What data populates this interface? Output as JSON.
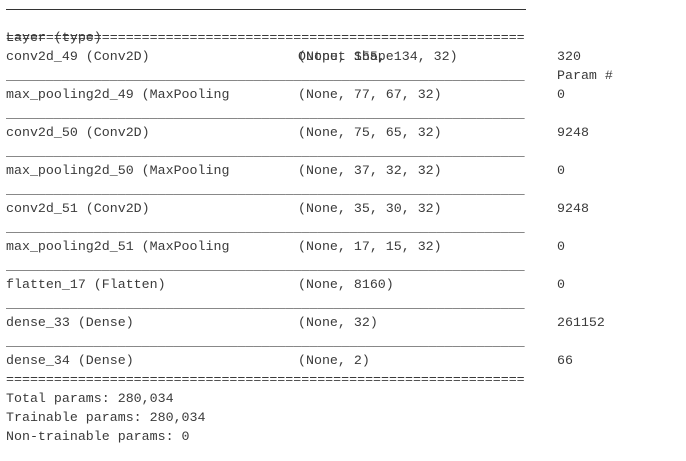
{
  "headers": {
    "layer": "Layer (type)",
    "output": "Output Shape",
    "param": "Param #"
  },
  "rows": [
    {
      "layer": "conv2d_49 (Conv2D)",
      "output": "(None, 155, 134, 32)",
      "param": "320"
    },
    {
      "layer": "max_pooling2d_49 (MaxPooling",
      "output": "(None, 77, 67, 32)",
      "param": "0"
    },
    {
      "layer": "conv2d_50 (Conv2D)",
      "output": "(None, 75, 65, 32)",
      "param": "9248"
    },
    {
      "layer": "max_pooling2d_50 (MaxPooling",
      "output": "(None, 37, 32, 32)",
      "param": "0"
    },
    {
      "layer": "conv2d_51 (Conv2D)",
      "output": "(None, 35, 30, 32)",
      "param": "9248"
    },
    {
      "layer": "max_pooling2d_51 (MaxPooling",
      "output": "(None, 17, 15, 32)",
      "param": "0"
    },
    {
      "layer": "flatten_17 (Flatten)",
      "output": "(None, 8160)",
      "param": "0"
    },
    {
      "layer": "dense_33 (Dense)",
      "output": "(None, 32)",
      "param": "261152"
    },
    {
      "layer": "dense_34 (Dense)",
      "output": "(None, 2)",
      "param": "66"
    }
  ],
  "separators": {
    "double": "=================================================================",
    "single": "_________________________________________________________________"
  },
  "totals": {
    "total": "Total params: 280,034",
    "trainable": "Trainable params: 280,034",
    "non_trainable": "Non-trainable params: 0"
  }
}
